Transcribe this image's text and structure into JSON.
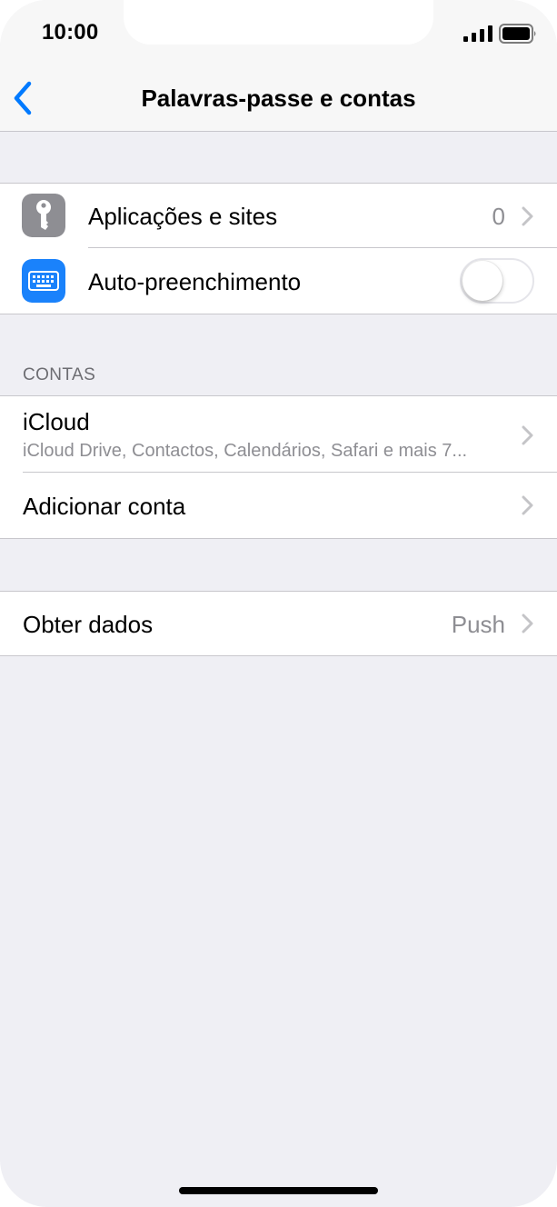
{
  "status_bar": {
    "time": "10:00",
    "signal_icon": "signal-icon",
    "battery_icon": "battery-icon"
  },
  "nav": {
    "title": "Palavras-passe e contas",
    "back_icon": "chevron-left-icon"
  },
  "passwords_group": {
    "apps_sites": {
      "label": "Aplicações e sites",
      "value": "0",
      "icon": "key-icon"
    },
    "autofill": {
      "label": "Auto-preenchimento",
      "icon": "keyboard-icon",
      "enabled": false
    }
  },
  "accounts": {
    "header": "CONTAS",
    "icloud": {
      "label": "iCloud",
      "detail": "iCloud Drive, Contactos, Calendários, Safari e mais 7..."
    },
    "add_account": {
      "label": "Adicionar conta"
    }
  },
  "fetch_group": {
    "fetch_data": {
      "label": "Obter dados",
      "value": "Push"
    }
  },
  "colors": {
    "accent": "#007aff",
    "background": "#efeff4",
    "separator": "#c8c7cc",
    "secondary_text": "#8e8e93",
    "key_icon_bg": "#8e8e93"
  }
}
